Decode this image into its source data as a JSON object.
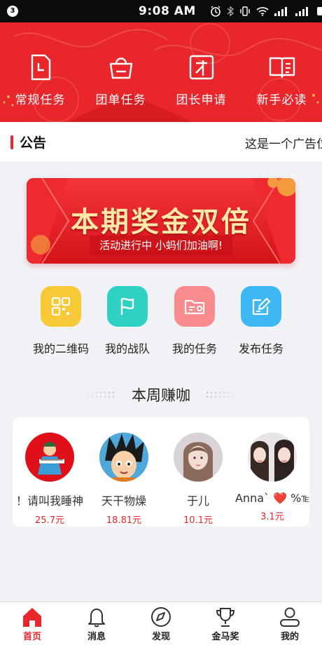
{
  "status_bar": {
    "notification_count": "3",
    "time": "9:08 AM"
  },
  "quick_actions": [
    {
      "label": "常规任务",
      "icon": "document-icon"
    },
    {
      "label": "团单任务",
      "icon": "basket-icon"
    },
    {
      "label": "团长申请",
      "icon": "apply-card-icon"
    },
    {
      "label": "新手必读",
      "icon": "book-icon"
    }
  ],
  "notice": {
    "title": "公告",
    "text": "这是一个广告位"
  },
  "banner": {
    "title": "本期奖金双倍",
    "subtitle": "活动进行中 小蚂们加油啊!"
  },
  "features": [
    {
      "label": "我的二维码",
      "icon": "qr-grid-icon",
      "color": "#f8c937"
    },
    {
      "label": "我的战队",
      "icon": "flag-icon",
      "color": "#2ed1c4"
    },
    {
      "label": "我的任务",
      "icon": "folder-icon",
      "color": "#f98b8f"
    },
    {
      "label": "发布任务",
      "icon": "edit-icon",
      "color": "#3db8f5"
    }
  ],
  "weekly": {
    "title": "本周赚咖",
    "earners": [
      {
        "name": "！请叫我睡神",
        "amount": "25.7元"
      },
      {
        "name": "天干物燥",
        "amount": "18.81元"
      },
      {
        "name": "于儿",
        "amount": "10.1元"
      },
      {
        "name": "Anna` ❤️ %℡",
        "amount": "3.1元"
      }
    ]
  },
  "tabs": [
    {
      "label": "首页",
      "icon": "home-icon",
      "active": true
    },
    {
      "label": "消息",
      "icon": "bell-icon",
      "active": false
    },
    {
      "label": "发现",
      "icon": "compass-icon",
      "active": false
    },
    {
      "label": "金马奖",
      "icon": "trophy-icon",
      "active": false
    },
    {
      "label": "我的",
      "icon": "user-icon",
      "active": false
    }
  ],
  "colors": {
    "brand_red": "#e8262b",
    "banner_gold": "#ffe9a8",
    "amount_red": "#e8262b"
  }
}
